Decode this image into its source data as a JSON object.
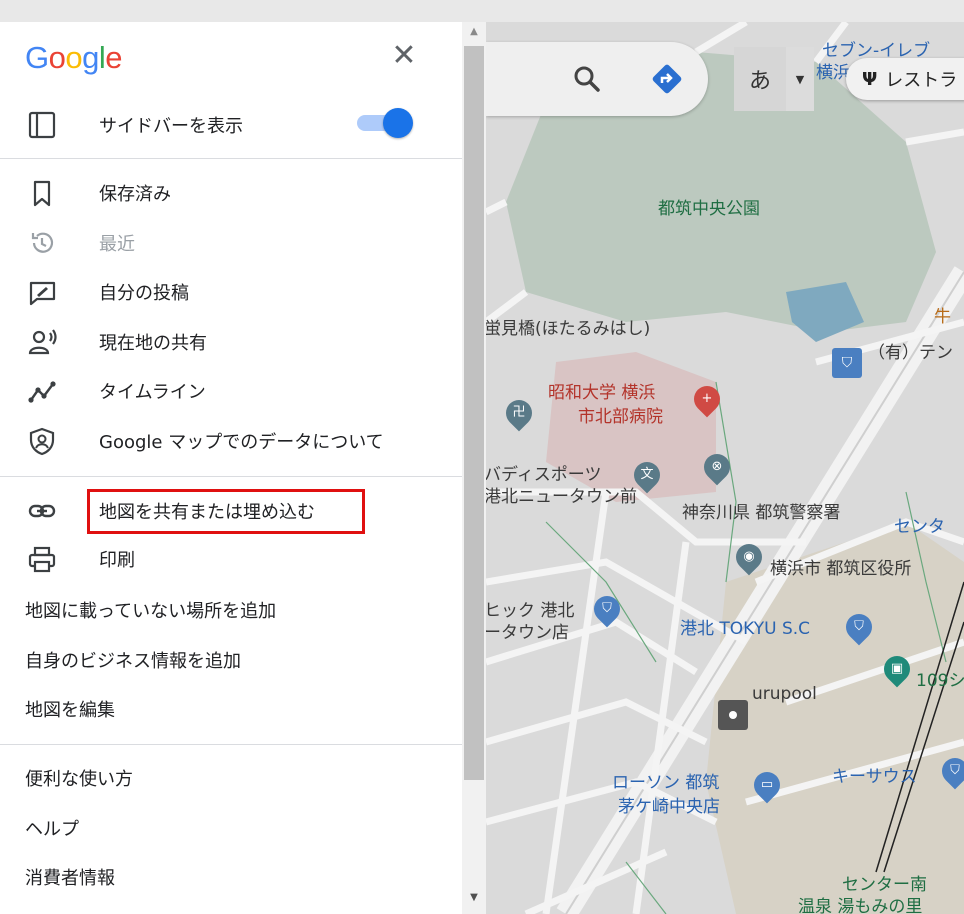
{
  "logo": {
    "letters": [
      "G",
      "o",
      "o",
      "g",
      "l",
      "e"
    ],
    "colors": [
      "#4285f4",
      "#ea4335",
      "#fbbc05",
      "#4285f4",
      "#34a853",
      "#ea4335"
    ]
  },
  "menu": {
    "close_glyph": "✕",
    "sidebar_toggle": {
      "label": "サイドバーを表示",
      "on": true,
      "accent": "#1a73e8"
    },
    "group1": [
      {
        "icon": "bookmark-icon",
        "label": "保存済み",
        "dim": false
      },
      {
        "icon": "history-icon",
        "label": "最近",
        "dim": true
      },
      {
        "icon": "contribution-icon",
        "label": "自分の投稿",
        "dim": false
      },
      {
        "icon": "location-sharing-icon",
        "label": "現在地の共有",
        "dim": false
      },
      {
        "icon": "timeline-icon",
        "label": "タイムライン",
        "dim": false
      },
      {
        "icon": "shield-icon",
        "label": "Google マップでのデータについて",
        "dim": false
      }
    ],
    "group2": [
      {
        "icon": "link-icon",
        "label": "地図を共有または埋め込む"
      },
      {
        "icon": "print-icon",
        "label": "印刷"
      }
    ],
    "group2_text": [
      "地図に載っていない場所を追加",
      "自身のビジネス情報を追加",
      "地図を編集"
    ],
    "group3_text": [
      "便利な使い方",
      "ヘルプ",
      "消費者情報"
    ]
  },
  "map": {
    "ime_label": "あ",
    "ime_arrow": "▼",
    "chip_label": "レストラ",
    "labels": {
      "park": "都筑中央公園",
      "bridge": "蛍見橋(ほたるみはし)",
      "hospital_1": "昭和大学 横浜",
      "hospital_2": "市北部病院",
      "sports_1": "バディスポーツ",
      "sports_2": "港北ニュータウン前",
      "police": "神奈川県 都筑警察署",
      "ward_office": "横浜市 都筑区役所",
      "tokyu": "港北 TOKYU S.C",
      "pool": "urupool",
      "lawson_1": "ローソン 都筑",
      "lawson_2": "茅ケ崎中央店",
      "kisaus": "キーサウス",
      "center_south": "センター南",
      "onsen": "温泉 湯もみの里",
      "seven_1": "セブン-イレブ",
      "seven_2": "横浜",
      "ushi": "牛",
      "yu_te": "（有）テン",
      "center_r": "センタ",
      "cinema": "109シ",
      "shop_1": "ヒック 港北",
      "shop_2": "ータウン店"
    }
  }
}
